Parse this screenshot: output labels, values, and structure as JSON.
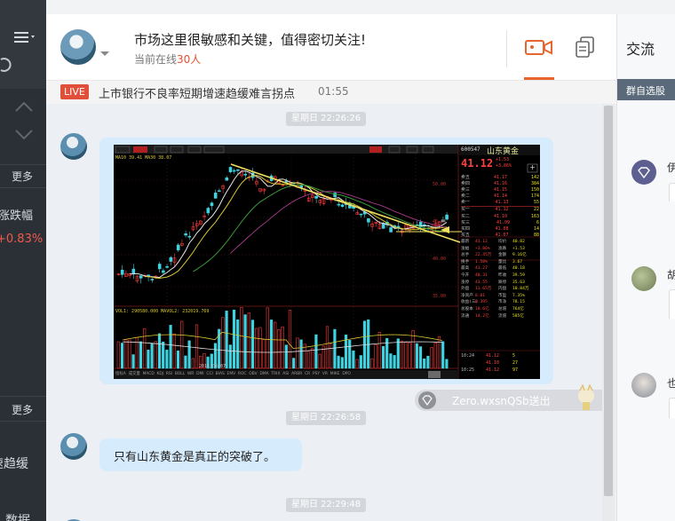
{
  "sidebar": {
    "more_1": "更多",
    "rise_fall_label": "涨跌幅",
    "rise_fall_value": "+0.83%",
    "more_2": "更多",
    "trend_snippet": "速趋缓",
    "data_snippet": "数据"
  },
  "header": {
    "title": "市场这里很敏感和关键，值得密切关注!",
    "online_prefix": "当前在线",
    "online_count": "30人",
    "right_label": "交流"
  },
  "news": {
    "badge": "LIVE",
    "text": "上市银行不良率短期增速趋缓难言拐点",
    "time": "01:55"
  },
  "right_panel": {
    "group_label": "群自选股",
    "names": [
      "伊",
      "胡",
      "也"
    ]
  },
  "chat": {
    "day_labels": [
      "星期日 22:26:26",
      "星期日 22:26:58",
      "星期日 22:29:48"
    ],
    "messages": [
      {
        "type": "image",
        "desc": "stock chart"
      },
      {
        "type": "text",
        "text": "只有山东黄金是真正的突破了。"
      }
    ],
    "gift_text": "Zero.wxsnQSb送出"
  },
  "stock": {
    "code": "600547",
    "name": "山东黄金",
    "price": "41.12",
    "change": "+1.53",
    "change_pct": "+3.86%",
    "ma_line": "MA10 39.41  MA30 38.07",
    "vol_line": "VOL1: 290580.000  MAVOL2: 232019.769",
    "date_label": "2016/04/07",
    "order_book": [
      [
        "卖五",
        "41.17",
        "142"
      ],
      [
        "卖四",
        "41.16",
        "384"
      ],
      [
        "卖三",
        "41.15",
        "150"
      ],
      [
        "卖二",
        "41.14",
        "174"
      ],
      [
        "卖一",
        "41.13",
        "55"
      ],
      [
        "买一",
        "41.12",
        "22"
      ],
      [
        "买二",
        "41.10",
        "163"
      ],
      [
        "买三",
        "41.09",
        "6"
      ],
      [
        "买四",
        "41.08",
        "14"
      ],
      [
        "买五",
        "41.07",
        "88"
      ]
    ],
    "quote_rows": [
      [
        "最新",
        "41.12",
        "均价",
        "40.82"
      ],
      [
        "涨幅",
        "+3.86%",
        "涨跌",
        "+1.53"
      ],
      [
        "总手",
        "22.45万",
        "金额",
        "9.16亿"
      ],
      [
        "换手",
        "1.58%",
        "量比",
        "3.67"
      ],
      [
        "最高",
        "41.27",
        "最低",
        "40.18"
      ],
      [
        "今开",
        "40.31",
        "昨收",
        "39.59"
      ],
      [
        "涨停",
        "43.55",
        "跌停",
        "35.63"
      ],
      [
        "外盘",
        "11.65万",
        "内盘",
        "10.84万"
      ],
      [
        "净资产",
        "8.01",
        "市盈",
        "7.35%"
      ],
      [
        "收益(三)",
        "0.395",
        "市净",
        "78.15"
      ],
      [
        "总股本",
        "18.6亿",
        "总值",
        "764亿"
      ],
      [
        "流通",
        "14.2亿",
        "流值",
        "585亿"
      ]
    ],
    "ticks": [
      [
        "10:24",
        "41.12",
        "5"
      ],
      [
        "",
        "41.10",
        "27"
      ],
      [
        "10:25",
        "41.12",
        "97"
      ]
    ],
    "axis_labels": [
      "50.00",
      "45.00",
      "40.00",
      "35.00",
      "30.00"
    ],
    "bottom_tabs": [
      "指标A",
      "成交量",
      "MACD",
      "KDJ",
      "RSI",
      "BOLL",
      "WR",
      "DMI",
      "CCI",
      "BIAS",
      "EMV",
      "ROC",
      "OBV",
      "DMA",
      "TRIX",
      "ASI",
      "ARBR",
      "CR",
      "PSY",
      "VR",
      "MIKE",
      "DPO"
    ]
  }
}
